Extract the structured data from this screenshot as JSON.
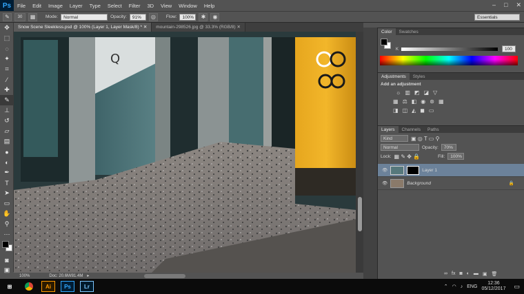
{
  "menubar": {
    "logo": "Ps",
    "items": [
      "File",
      "Edit",
      "Image",
      "Layer",
      "Type",
      "Select",
      "Filter",
      "3D",
      "View",
      "Window",
      "Help"
    ]
  },
  "options": {
    "brush_size": "30",
    "mode_label": "Mode:",
    "mode_value": "Normal",
    "opacity_label": "Opacity:",
    "opacity_value": "91%",
    "flow_label": "Flow:",
    "flow_value": "100%",
    "workspace": "Essentials"
  },
  "tabs": [
    {
      "label": "Snow Scene Sleekless.psd @ 100% (Layer 1, Layer Mask/8) *"
    },
    {
      "label": "mountain-298526.jpg @ 33.3% (RGB/8)"
    }
  ],
  "status": {
    "zoom": "100%",
    "doc": "Doc: 20.6M/81.4M"
  },
  "color_panel": {
    "tabs": [
      "Color",
      "Swatches"
    ],
    "k_label": "K",
    "k_value": "100"
  },
  "adjustments_panel": {
    "tabs": [
      "Adjustments",
      "Styles"
    ],
    "heading": "Add an adjustment"
  },
  "layers_panel": {
    "tabs": [
      "Layers",
      "Channels",
      "Paths"
    ],
    "kind": "Kind",
    "blend": "Normal",
    "opacity_label": "Opacity:",
    "opacity_value": "70%",
    "lock_label": "Lock:",
    "fill_label": "Fill:",
    "fill_value": "100%",
    "layers": [
      {
        "name": "Layer 1",
        "selected": true
      },
      {
        "name": "Background",
        "selected": false
      }
    ]
  },
  "taskbar": {
    "language": "ENG",
    "time": "12:36",
    "date": "05/12/2017"
  }
}
